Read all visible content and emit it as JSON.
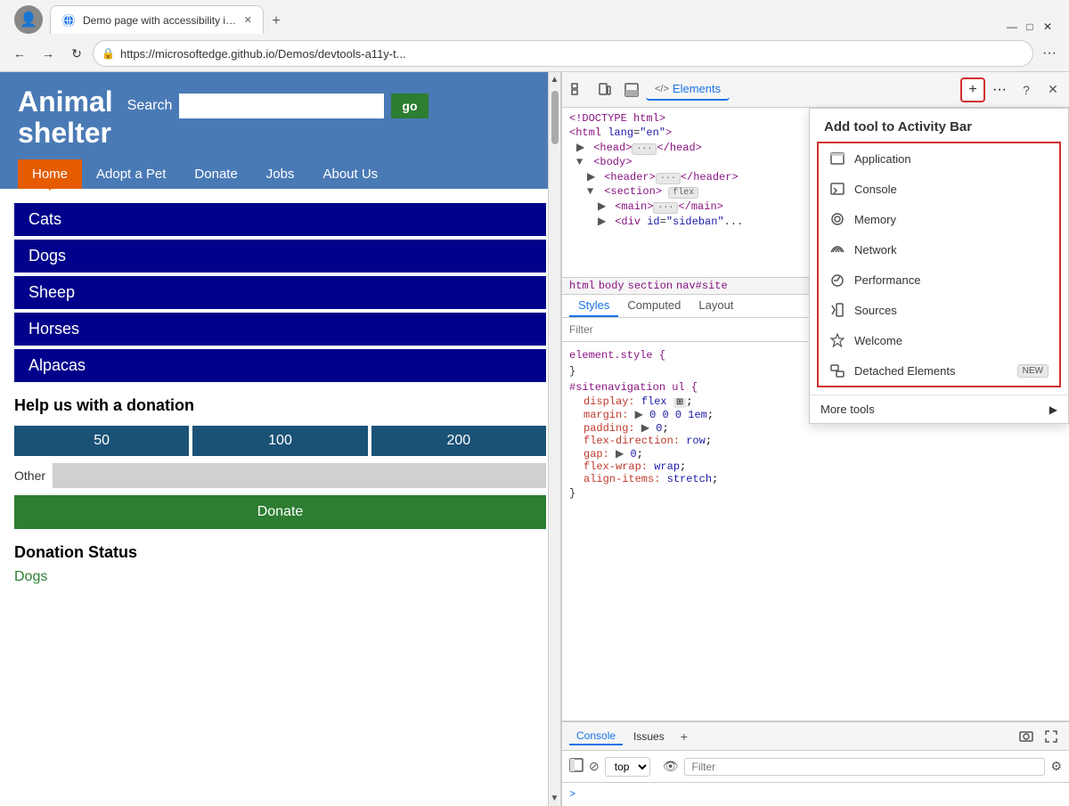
{
  "browser": {
    "tab_title": "Demo page with accessibility issu",
    "url": "https://microsoftedge.github.io/Demos/devtools-a11y-t...",
    "new_tab_icon": "+",
    "back_icon": "←",
    "forward_icon": "→",
    "refresh_icon": "↻",
    "menu_icon": "···"
  },
  "website": {
    "title_line1": "Animal",
    "title_line2": "shelter",
    "search_label": "Search",
    "go_button": "go",
    "nav_items": [
      "Home",
      "Adopt a Pet",
      "Donate",
      "Jobs",
      "About Us"
    ],
    "active_nav": "Home",
    "animals": [
      "Cats",
      "Dogs",
      "Sheep",
      "Horses",
      "Alpacas"
    ],
    "donation_title": "Help us with a donation",
    "amounts": [
      "50",
      "100",
      "200"
    ],
    "other_label": "Other",
    "donate_button": "Donate",
    "status_title": "Donation Status",
    "status_item": "Dogs"
  },
  "devtools": {
    "toolbar_tabs": [
      "Elements"
    ],
    "plus_icon": "+",
    "more_icon": "···",
    "help_icon": "?",
    "close_icon": "✕",
    "html_lines": [
      {
        "indent": 0,
        "content": "<!DOCTYPE html>"
      },
      {
        "indent": 0,
        "content": "<html lang=\"en\">"
      },
      {
        "indent": 1,
        "arrow": "▶",
        "content": "<head>···</head>"
      },
      {
        "indent": 1,
        "arrow": "▼",
        "content": "<body>"
      },
      {
        "indent": 2,
        "arrow": "▶",
        "content": "<header>···</header>"
      },
      {
        "indent": 2,
        "arrow": "▼",
        "content": "<section>",
        "badge": "flex"
      },
      {
        "indent": 3,
        "arrow": "▶",
        "content": "<main>···</main>"
      },
      {
        "indent": 3,
        "arrow": "▶",
        "content": "<div id=\"sideban\"..."
      }
    ],
    "breadcrumb": [
      "html",
      "body",
      "section",
      "nav#site"
    ],
    "sub_tabs": [
      "Styles",
      "Computed",
      "Layout"
    ],
    "active_sub_tab": "Styles",
    "filter_placeholder": "Filter",
    "css_lines": [
      {
        "type": "selector",
        "content": "element.style {"
      },
      {
        "type": "close",
        "content": "}"
      },
      {
        "type": "link",
        "href": "styles.css:156"
      },
      {
        "type": "selector",
        "content": "#sitenavigation ul {"
      },
      {
        "type": "prop",
        "prop": "display:",
        "val": "flex",
        "icon": "⊞"
      },
      {
        "type": "prop",
        "prop": "margin:",
        "val": "▶ 0 0 0 1em;"
      },
      {
        "type": "prop",
        "prop": "padding:",
        "val": "▶ 0;"
      },
      {
        "type": "prop",
        "prop": "flex-direction:",
        "val": "row;"
      },
      {
        "type": "prop",
        "prop": "gap:",
        "val": "▶ 0;"
      },
      {
        "type": "prop",
        "prop": "flex-wrap:",
        "val": "wrap;"
      },
      {
        "type": "prop",
        "prop": "align-items:",
        "val": "stretch;"
      },
      {
        "type": "close",
        "content": "}"
      }
    ],
    "dropdown": {
      "title": "Add tool to Activity Bar",
      "items": [
        {
          "label": "Application",
          "icon": "app"
        },
        {
          "label": "Console",
          "icon": "console"
        },
        {
          "label": "Memory",
          "icon": "memory"
        },
        {
          "label": "Network",
          "icon": "network"
        },
        {
          "label": "Performance",
          "icon": "perf"
        },
        {
          "label": "Sources",
          "icon": "sources"
        },
        {
          "label": "Welcome",
          "icon": "welcome"
        },
        {
          "label": "Detached Elements",
          "icon": "detached",
          "badge": "NEW"
        }
      ],
      "more_tools": "More tools"
    },
    "console": {
      "tabs": [
        "Console",
        "Issues"
      ],
      "add_icon": "+",
      "top_label": "top",
      "filter_placeholder": "Filter"
    }
  }
}
